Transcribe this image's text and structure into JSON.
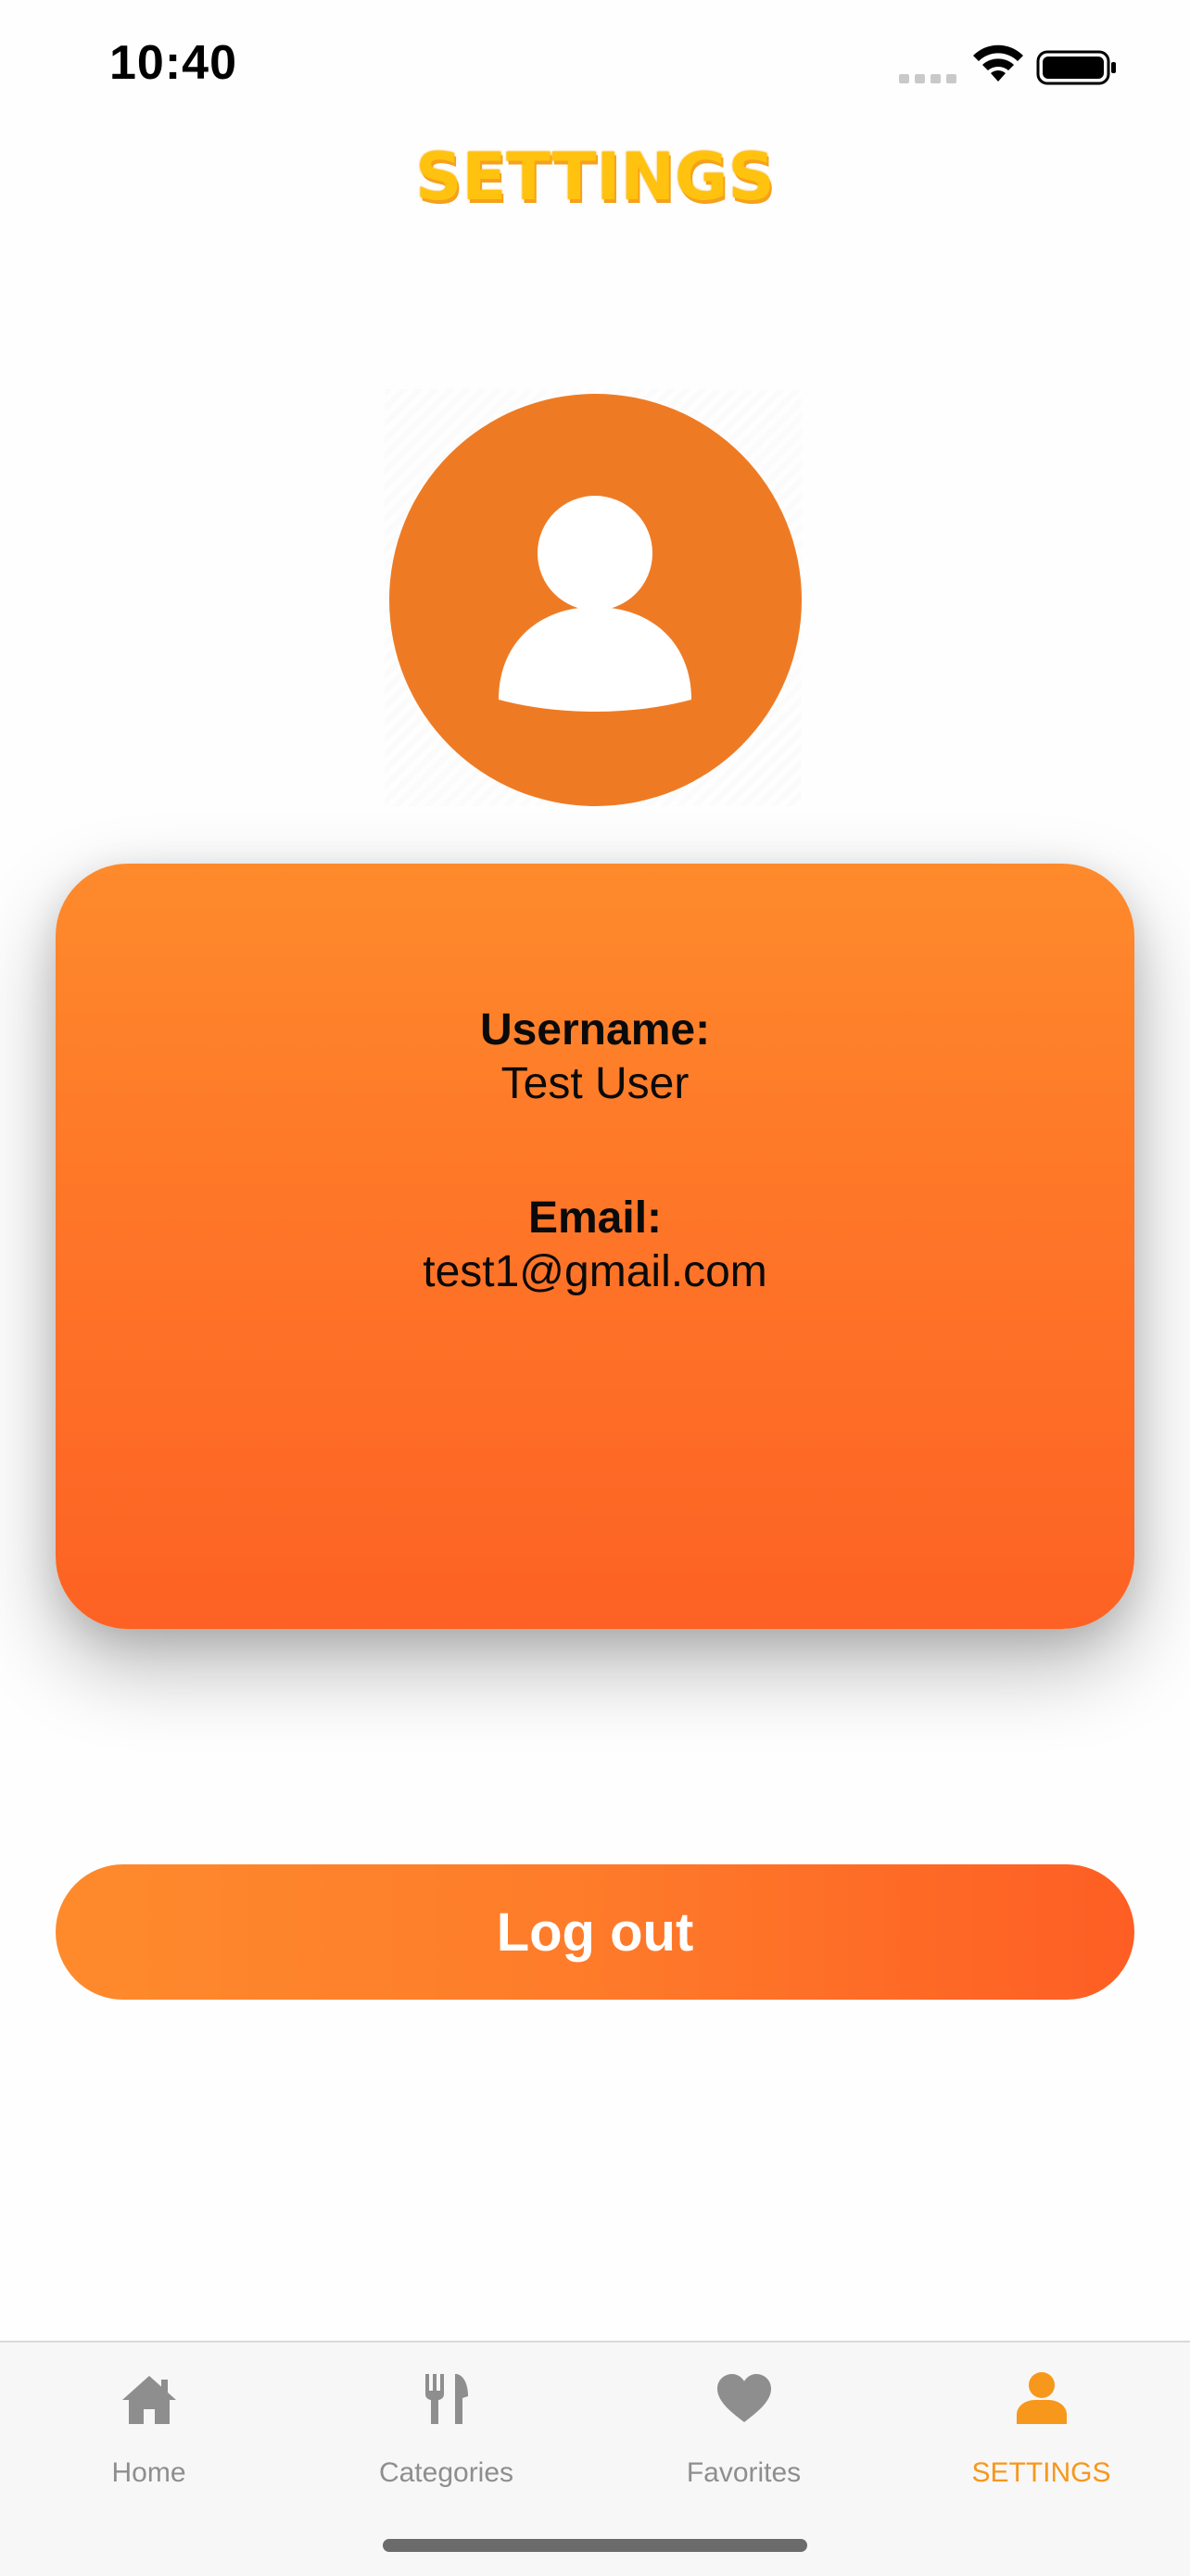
{
  "status_bar": {
    "time": "10:40",
    "signal_icon": "cellular-signal-icon",
    "wifi_icon": "wifi-icon",
    "battery_icon": "battery-icon"
  },
  "header": {
    "title": "SETTINGS"
  },
  "profile": {
    "avatar_icon": "user-avatar-icon",
    "username_label": "Username:",
    "username_value": "Test User",
    "email_label": "Email:",
    "email_value": "test1@gmail.com"
  },
  "actions": {
    "logout_label": "Log out"
  },
  "tab_bar": {
    "tabs": [
      {
        "label": "Home",
        "icon": "home-icon",
        "active": false
      },
      {
        "label": "Categories",
        "icon": "fork-knife-icon",
        "active": false
      },
      {
        "label": "Favorites",
        "icon": "heart-icon",
        "active": false
      },
      {
        "label": "SETTINGS",
        "icon": "user-icon",
        "active": true
      }
    ]
  },
  "colors": {
    "accent": "#f7971c",
    "title": "#ffc20e",
    "card_top": "#fe8a2c",
    "card_bottom": "#fd6224",
    "avatar_bg": "#ee7b24",
    "inactive_tab": "#8e8e8e"
  }
}
